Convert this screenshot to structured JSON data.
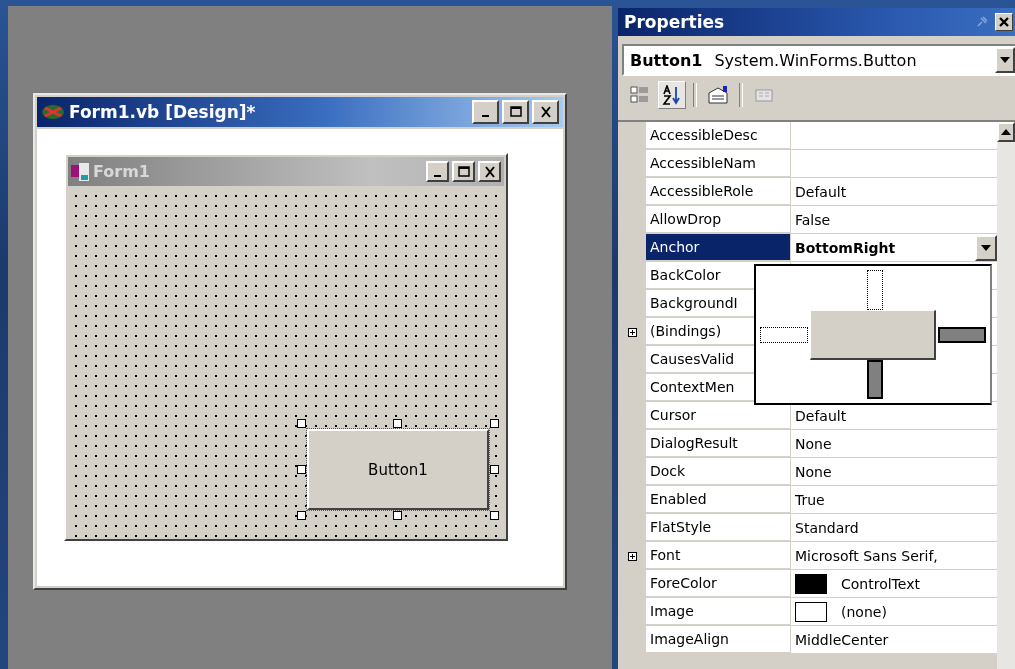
{
  "designer_window": {
    "title": "Form1.vb [Design]*",
    "form": {
      "title": "Form1",
      "button": {
        "label": "Button1",
        "selected": true
      }
    }
  },
  "properties": {
    "title": "Properties",
    "object": {
      "name": "Button1",
      "type": "System.WinForms.Button"
    },
    "toolbar": [
      {
        "kind": "categorized",
        "selected": false
      },
      {
        "kind": "alphabetical",
        "selected": true
      },
      {
        "kind": "property-pages",
        "selected": false
      },
      {
        "kind": "events",
        "selected": false
      }
    ],
    "rows": [
      {
        "name": "AccessibleDesc",
        "value": "",
        "expandable": false,
        "selected": false
      },
      {
        "name": "AccessibleNam",
        "value": "",
        "expandable": false,
        "selected": false
      },
      {
        "name": "AccessibleRole",
        "value": "Default",
        "expandable": false,
        "selected": false
      },
      {
        "name": "AllowDrop",
        "value": "False",
        "expandable": false,
        "selected": false
      },
      {
        "name": "Anchor",
        "value": "BottomRight",
        "expandable": false,
        "selected": true
      },
      {
        "name": "BackColor",
        "value": "",
        "expandable": false,
        "selected": false
      },
      {
        "name": "BackgroundI",
        "value": "",
        "expandable": false,
        "selected": false
      },
      {
        "name": "(Bindings)",
        "value": "",
        "expandable": true,
        "selected": false
      },
      {
        "name": "CausesValid",
        "value": "",
        "expandable": false,
        "selected": false
      },
      {
        "name": "ContextMen",
        "value": "",
        "expandable": false,
        "selected": false
      },
      {
        "name": "Cursor",
        "value": "Default",
        "expandable": false,
        "selected": false
      },
      {
        "name": "DialogResult",
        "value": "None",
        "expandable": false,
        "selected": false
      },
      {
        "name": "Dock",
        "value": "None",
        "expandable": false,
        "selected": false
      },
      {
        "name": "Enabled",
        "value": "True",
        "expandable": false,
        "selected": false
      },
      {
        "name": "FlatStyle",
        "value": "Standard",
        "expandable": false,
        "selected": false
      },
      {
        "name": "Font",
        "value": "Microsoft Sans Serif,",
        "expandable": true,
        "selected": false
      },
      {
        "name": "ForeColor",
        "value": "ControlText",
        "color": "#000000",
        "expandable": false,
        "selected": false
      },
      {
        "name": "Image",
        "value": "(none)",
        "color": "#ffffff",
        "expandable": false,
        "selected": false
      },
      {
        "name": "ImageAlign",
        "value": "MiddleCenter",
        "expandable": false,
        "selected": false
      }
    ],
    "anchor_editor": {
      "top": false,
      "left": false,
      "right": true,
      "bottom": true
    }
  }
}
